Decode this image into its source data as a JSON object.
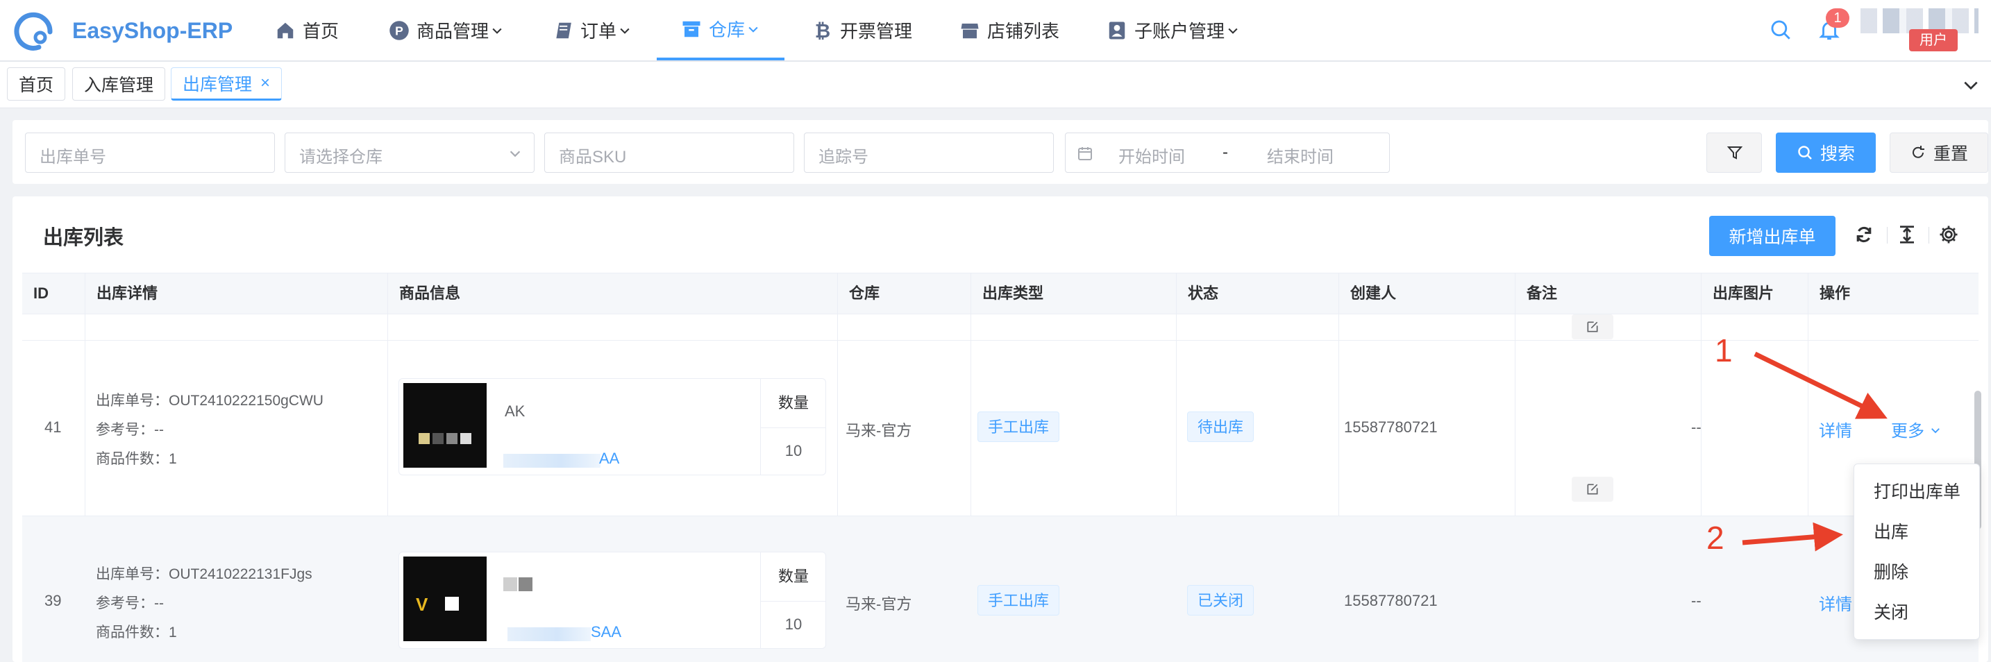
{
  "app": {
    "brand": "EasyShop-ERP"
  },
  "nav": [
    {
      "label": "首页",
      "icon": "home-icon"
    },
    {
      "label": "商品管理",
      "icon": "product-icon"
    },
    {
      "label": "订单",
      "icon": "book-icon"
    },
    {
      "label": "仓库",
      "icon": "archive-icon"
    },
    {
      "label": "开票管理",
      "icon": "bitcoin-icon"
    },
    {
      "label": "店铺列表",
      "icon": "store-icon"
    },
    {
      "label": "子账户管理",
      "icon": "user-icon"
    }
  ],
  "header": {
    "notification_count": "1",
    "user_label": "用户"
  },
  "tabs": [
    {
      "label": "首页"
    },
    {
      "label": "入库管理"
    },
    {
      "label": "出库管理",
      "close": "×"
    }
  ],
  "filters": {
    "order_no_placeholder": "出库单号",
    "warehouse_placeholder": "请选择仓库",
    "sku_placeholder": "商品SKU",
    "tracking_placeholder": "追踪号",
    "start_time_placeholder": "开始时间",
    "date_separator": "-",
    "end_time_placeholder": "结束时间",
    "search_label": "搜索",
    "reset_label": "重置"
  },
  "list": {
    "title": "出库列表",
    "add_label": "新增出库单",
    "columns": [
      "ID",
      "出库详情",
      "商品信息",
      "仓库",
      "出库类型",
      "状态",
      "创建人",
      "备注",
      "出库图片",
      "操作"
    ],
    "qty_header": "数量",
    "rows": [
      {
        "id": "41",
        "order_no": "出库单号：OUT2410222150gCWU",
        "ref_no": "参考号：--",
        "item_count": "商品件数：1",
        "product_name": "AK",
        "product_sku_tail": "AA",
        "qty": "10",
        "warehouse": "马来-官方",
        "type": "手工出库",
        "status": "待出库",
        "creator": "15587780721",
        "image": "--",
        "action_detail": "详情",
        "action_more": "更多"
      },
      {
        "id": "39",
        "order_no": "出库单号：OUT2410222131FJgs",
        "ref_no": "参考号：--",
        "item_count": "商品件数：1",
        "product_name": "V",
        "product_sku_tail": "SAA",
        "qty": "10",
        "warehouse": "马来-官方",
        "type": "手工出库",
        "status": "已关闭",
        "creator": "15587780721",
        "image": "--",
        "action_detail": "详情"
      }
    ]
  },
  "dropdown": [
    "打印出库单",
    "出库",
    "删除",
    "关闭"
  ],
  "annotations": {
    "step1": "1",
    "step2": "2"
  },
  "colors": {
    "primary": "#409eff",
    "annotation": "#e8402a",
    "badge": "#f56c6c"
  }
}
